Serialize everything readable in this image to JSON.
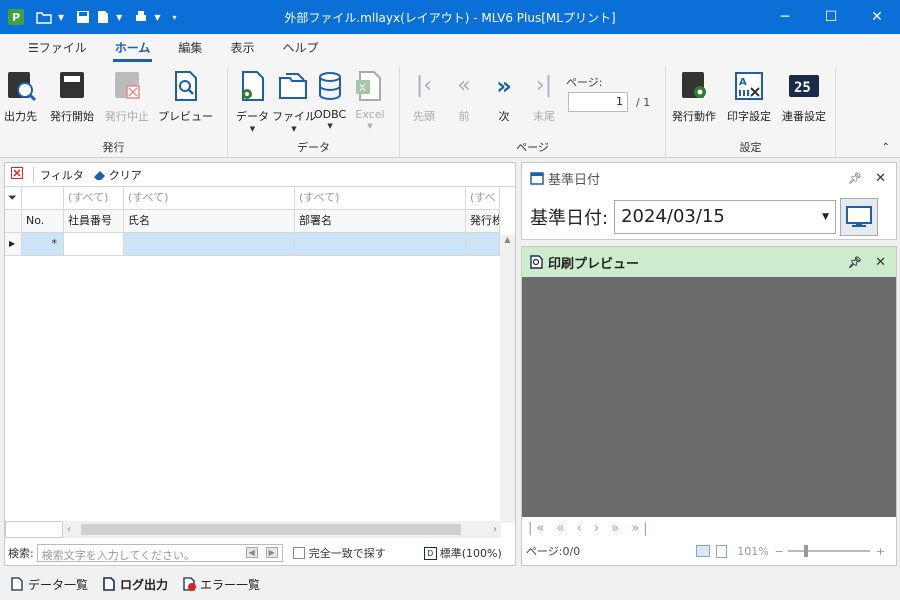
{
  "window": {
    "title": "外部ファイル.mllayx(レイアウト) - MLV6 Plus[MLプリント]",
    "logo_letter": "P",
    "minimize": "─",
    "maximize": "☐",
    "close": "✕"
  },
  "menu": {
    "file": "ファイル",
    "home": "ホーム",
    "edit": "編集",
    "view": "表示",
    "help": "ヘルプ"
  },
  "ribbon": {
    "issue": {
      "label": "発行",
      "output": "出力先",
      "start": "発行開始",
      "stop": "発行中止",
      "preview": "プレビュー"
    },
    "data": {
      "label": "データ",
      "data": "データ",
      "file": "ファイル",
      "odbc": "ODBC",
      "excel": "Excel"
    },
    "page": {
      "label": "ページ",
      "first": "先頭",
      "prev": "前",
      "next": "次",
      "last": "末尾",
      "page_label": "ページ:",
      "current": "1",
      "total": "/ 1"
    },
    "settings": {
      "label": "設定",
      "issue_action": "発行動作",
      "print_setting": "印字設定",
      "serial_setting": "連番設定"
    }
  },
  "grid": {
    "filter_label": "フィルタ",
    "clear_label": "クリア",
    "filter_all": "(すべて)",
    "filter_cut": "(すべ",
    "columns": [
      "No.",
      "社員番号",
      "氏名",
      "部署名",
      "発行枚"
    ],
    "new_row_marker": "*"
  },
  "search": {
    "label": "検索:",
    "placeholder": "検索文字を入力してください。",
    "exact_match": "完全一致で探す",
    "zoom": "標準(100%)"
  },
  "base_date": {
    "panel_title": "基準日付",
    "label": "基準日付:",
    "value": "2024/03/15"
  },
  "print_preview": {
    "panel_title": "印刷プレビュー",
    "page_status": "ページ:0/0",
    "zoom": "101%",
    "nav": "|« « ‹ › » »|"
  },
  "bottom_tabs": {
    "data_list": "データ一覧",
    "log_output": "ログ出力",
    "error_list": "エラー一覧"
  },
  "colors": {
    "titlebar": "#0a6fd6",
    "accent": "#1d5fa8",
    "preview_header": "#cdeccd",
    "selected_row": "#cce4f7"
  }
}
